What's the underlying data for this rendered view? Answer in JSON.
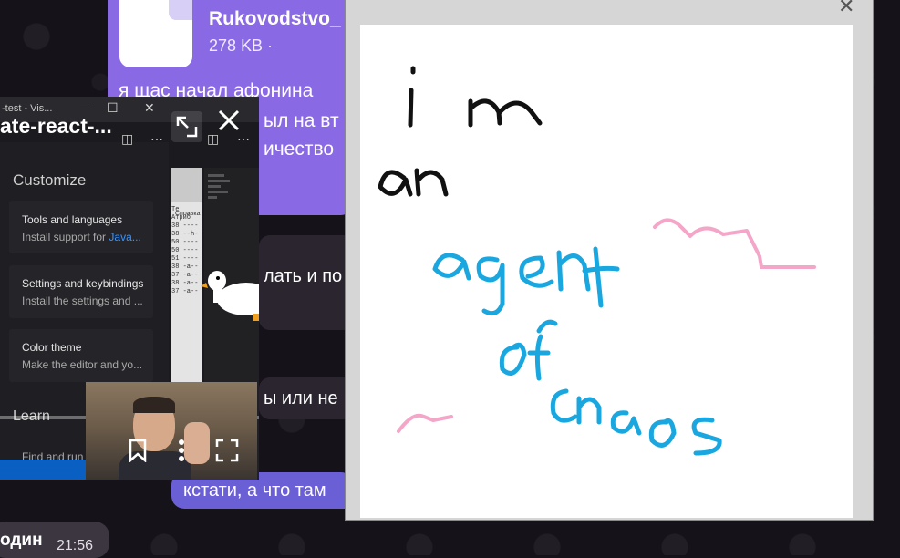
{
  "chat": {
    "file": {
      "name": "Rukovodstvo_",
      "size": "278 KB ·"
    },
    "purple_message_lines": [
      "я щас начал афонина",
      "ыл на вт",
      "ичество"
    ],
    "dark_message_1": "лать и по",
    "dark_message_2": "ы или не",
    "blue_message": "кстати, а что там",
    "sender": "один",
    "time": "21:56"
  },
  "pip": {
    "title": "ate-react-...",
    "window_title": "-test - Vis...",
    "window_controls": [
      "—",
      "☐",
      "✕"
    ],
    "expand_icon": "⇱",
    "close_icon": "✕",
    "vscode": {
      "heading": "Customize",
      "cards": [
        {
          "title": "Tools and languages",
          "desc_prefix": "Install support for ",
          "desc_link": "Java..."
        },
        {
          "title": "Settings and keybindings",
          "desc": "Install the settings and ..."
        },
        {
          "title": "Color theme",
          "desc": "Make the editor and yo..."
        }
      ],
      "learn": "Learn",
      "find_run": "Find and run"
    },
    "side_panel": {
      "label": "Справка",
      "header": "Атриб",
      "te": "Te",
      "rows": [
        "38 ----",
        "38 --h-",
        "50 ----",
        "50 ----",
        "51 ----",
        "38 -a--",
        "37 -a--",
        "38 -a--",
        "37 -a--"
      ]
    },
    "webcam_controls": {
      "bookmark_icon": "🔖",
      "more_icon": "⋮",
      "fullscreen_icon": "⛶"
    }
  },
  "drawing": {
    "close_icon": "✕",
    "canvas_strokes": {
      "black": "i m an",
      "blue": "agent of chaos"
    },
    "colors": {
      "black_ink": "#111111",
      "blue_ink": "#1aa7e0",
      "pink_ink": "#f3a6c8"
    }
  }
}
